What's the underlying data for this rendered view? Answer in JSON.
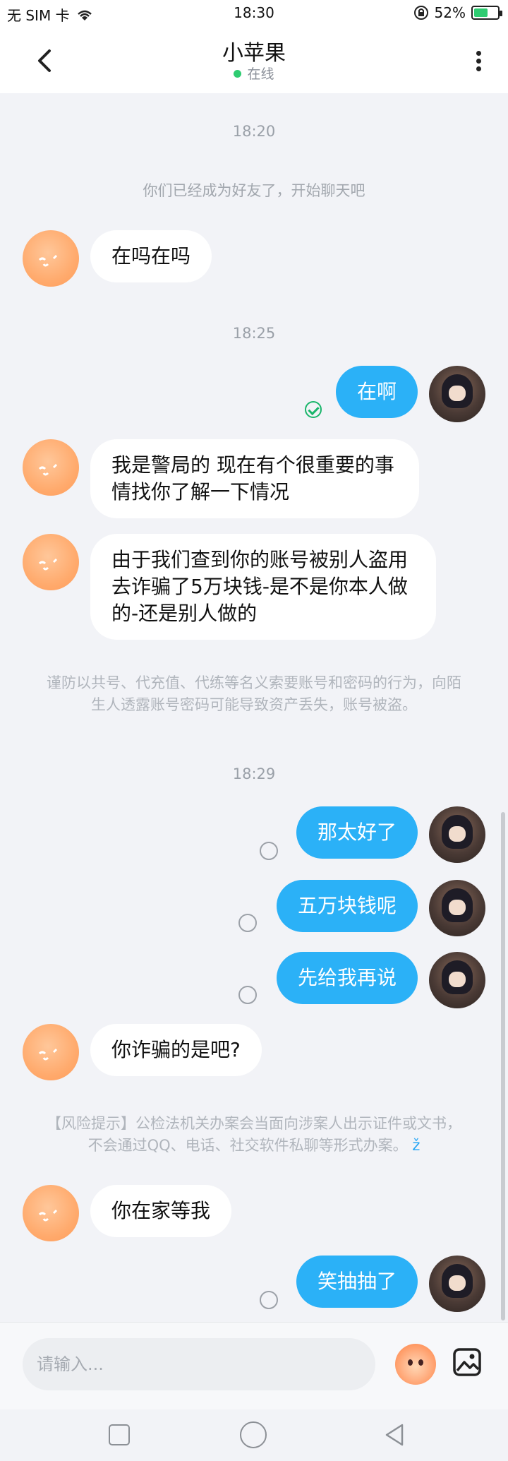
{
  "status_bar": {
    "carrier": "无 SIM 卡",
    "time": "18:30",
    "battery": "52%",
    "battery_level": 0.52,
    "icons": [
      "wifi-icon",
      "lock-rotation-icon",
      "battery-icon"
    ]
  },
  "header": {
    "title": "小苹果",
    "status": "在线",
    "back_icon": "chevron-left-icon",
    "more_icon": "more-vertical-icon"
  },
  "chat": {
    "time_1": "18:20",
    "system_message": "你们已经成为好友了，开始聊天吧",
    "msg_1": "在吗在吗",
    "time_2": "18:25",
    "msg_2": "在啊",
    "msg_3": "我是警局的 现在有个很重要的事情找你了解一下情况",
    "msg_4": "由于我们查到你的账号被别人盗用去诈骗了5万块钱-是不是你本人做的-还是别人做的",
    "warning_1": "谨防以共号、代充值、代练等名义索要账号和密码的行为，向陌生人透露账号密码可能导致资产丢失，账号被盗。",
    "time_3": "18:29",
    "msg_5": "那太好了",
    "msg_6": "五万块钱呢",
    "msg_7": "先给我再说",
    "msg_8": "你诈骗的是吧?",
    "warning_2_text": "【风险提示】公检法机关办案会当面向涉案人出示证件或文书，不会通过QQ、电话、社交软件私聊等形式办案。",
    "warning_2_link": "ž",
    "msg_9": "你在家等我",
    "msg_10": "笑抽抽了"
  },
  "input_bar": {
    "placeholder": "请输入...",
    "mascot_icon": "mascot-icon",
    "image_icon": "image-icon"
  },
  "nav_bar": {
    "icons": [
      "recent-apps-icon",
      "home-icon",
      "back-icon"
    ]
  },
  "colors": {
    "outgoing_bubble": "#2bb1f7",
    "incoming_bubble": "#ffffff",
    "background": "#f2f3f7",
    "online_dot": "#2ecc71"
  }
}
